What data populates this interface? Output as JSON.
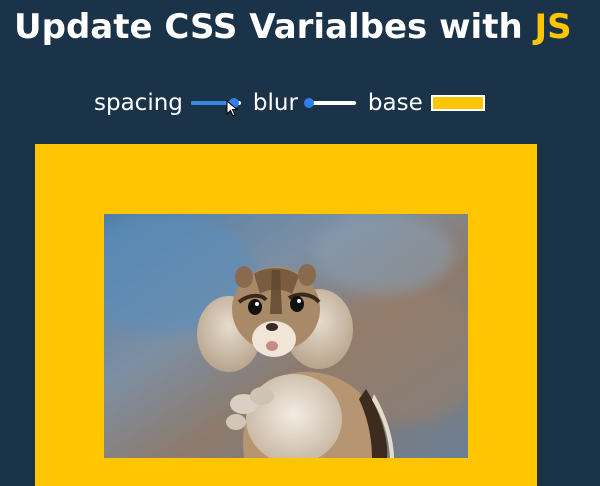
{
  "title": {
    "main": "Update CSS Varialbes with ",
    "highlight": "JS"
  },
  "controls": {
    "spacing": {
      "label": "spacing",
      "value_fraction": 0.86
    },
    "blur": {
      "label": "blur",
      "value_fraction": 0.06
    },
    "base": {
      "label": "base",
      "value": "#ffc600"
    }
  },
  "colors": {
    "background": "#1b3349",
    "accent": "#ffc600",
    "slider_fill": "#3a86e0",
    "slider_thumb": "#2d7ff0"
  },
  "image": {
    "subject": "chipmunk photo"
  }
}
